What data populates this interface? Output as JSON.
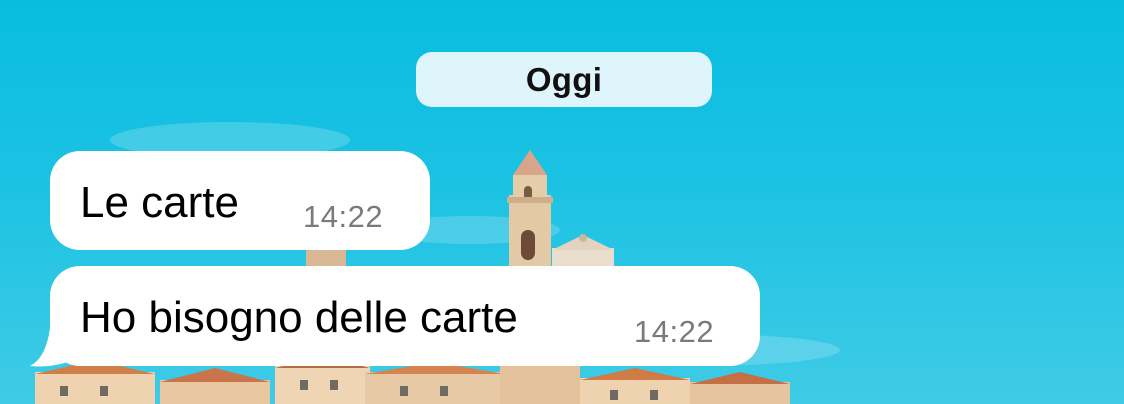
{
  "chat": {
    "date_separator": "Oggi",
    "messages": [
      {
        "text": "Le carte",
        "time": "14:22"
      },
      {
        "text": "Ho bisogno delle carte",
        "time": "14:22"
      }
    ]
  },
  "colors": {
    "sky": "#08bde0",
    "bubble": "#ffffff",
    "date_pill": "#e7f7fc",
    "timestamp": "#7a7a7a"
  },
  "wallpaper": {
    "subject": "hilltop village with bell tower"
  }
}
